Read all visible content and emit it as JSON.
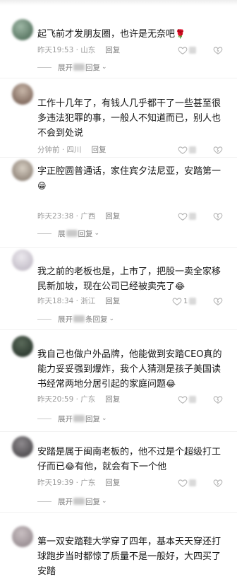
{
  "colors": {
    "text": "#161616",
    "meta": "#9b9b9b",
    "icon": "#b5b5b5"
  },
  "comments": [
    {
      "text": "起飞前才发朋友圈，也许是无奈吧",
      "emoji": "🌹",
      "time": "昨天19:53",
      "region": "山东",
      "reply": "回复",
      "expand_prefix": "展开",
      "expand_suffix": "回复",
      "icons": [
        "heart-outline-icon",
        "dislike-icon",
        "chevron-down-icon",
        "rose-emoji-icon"
      ]
    },
    {
      "text": "工作十几年了，有钱人几乎都干了一些甚至很多违法犯罪的事，一般人不知道而已，别人也不会到处说",
      "time": "分钟前",
      "region": "四川",
      "reply": "回复"
    },
    {
      "text": "字正腔圆普通话，家住宾夕法尼亚，安踏第一",
      "emoji": "😁",
      "time": "昨天23:38",
      "region": "广西",
      "reply": "回复",
      "expand_prefix": "展",
      "expand_suffix": "回复"
    },
    {
      "text": "我之前的老板也是，上市了，把股一卖全家移民新加坡，现在公司已经被卖壳了",
      "emoji": "😂",
      "time": "昨天18:34",
      "region": "浙江",
      "reply": "回复",
      "likes": "1",
      "expand_prefix": "展开",
      "expand_suffix": "条回复"
    },
    {
      "text": "我自己也做户外品牌，他能做到安踏CEO真的能力妥妥强到爆炸，我个人猜测是孩子美国读书经常两地分居引起的家庭问题",
      "emoji": "😂",
      "time": "昨天20:59",
      "region": "广东",
      "reply": "回复",
      "expand_prefix": "展开",
      "expand_suffix": "回复"
    },
    {
      "text_before": "安踏是属于闽南老板的，他不过是个超级打工仔而已",
      "emoji": "😂",
      "text_after": "有他，就会有下一个他",
      "time": "昨天19:39",
      "region": "广东",
      "reply": "回复",
      "expand_prefix": "展开",
      "expand_suffix": "回复"
    },
    {
      "text": "第一双安踏鞋大学穿了四年，基本天天穿还打球跑步当时都惊了质量不是一般好，大四买了安踏"
    }
  ]
}
